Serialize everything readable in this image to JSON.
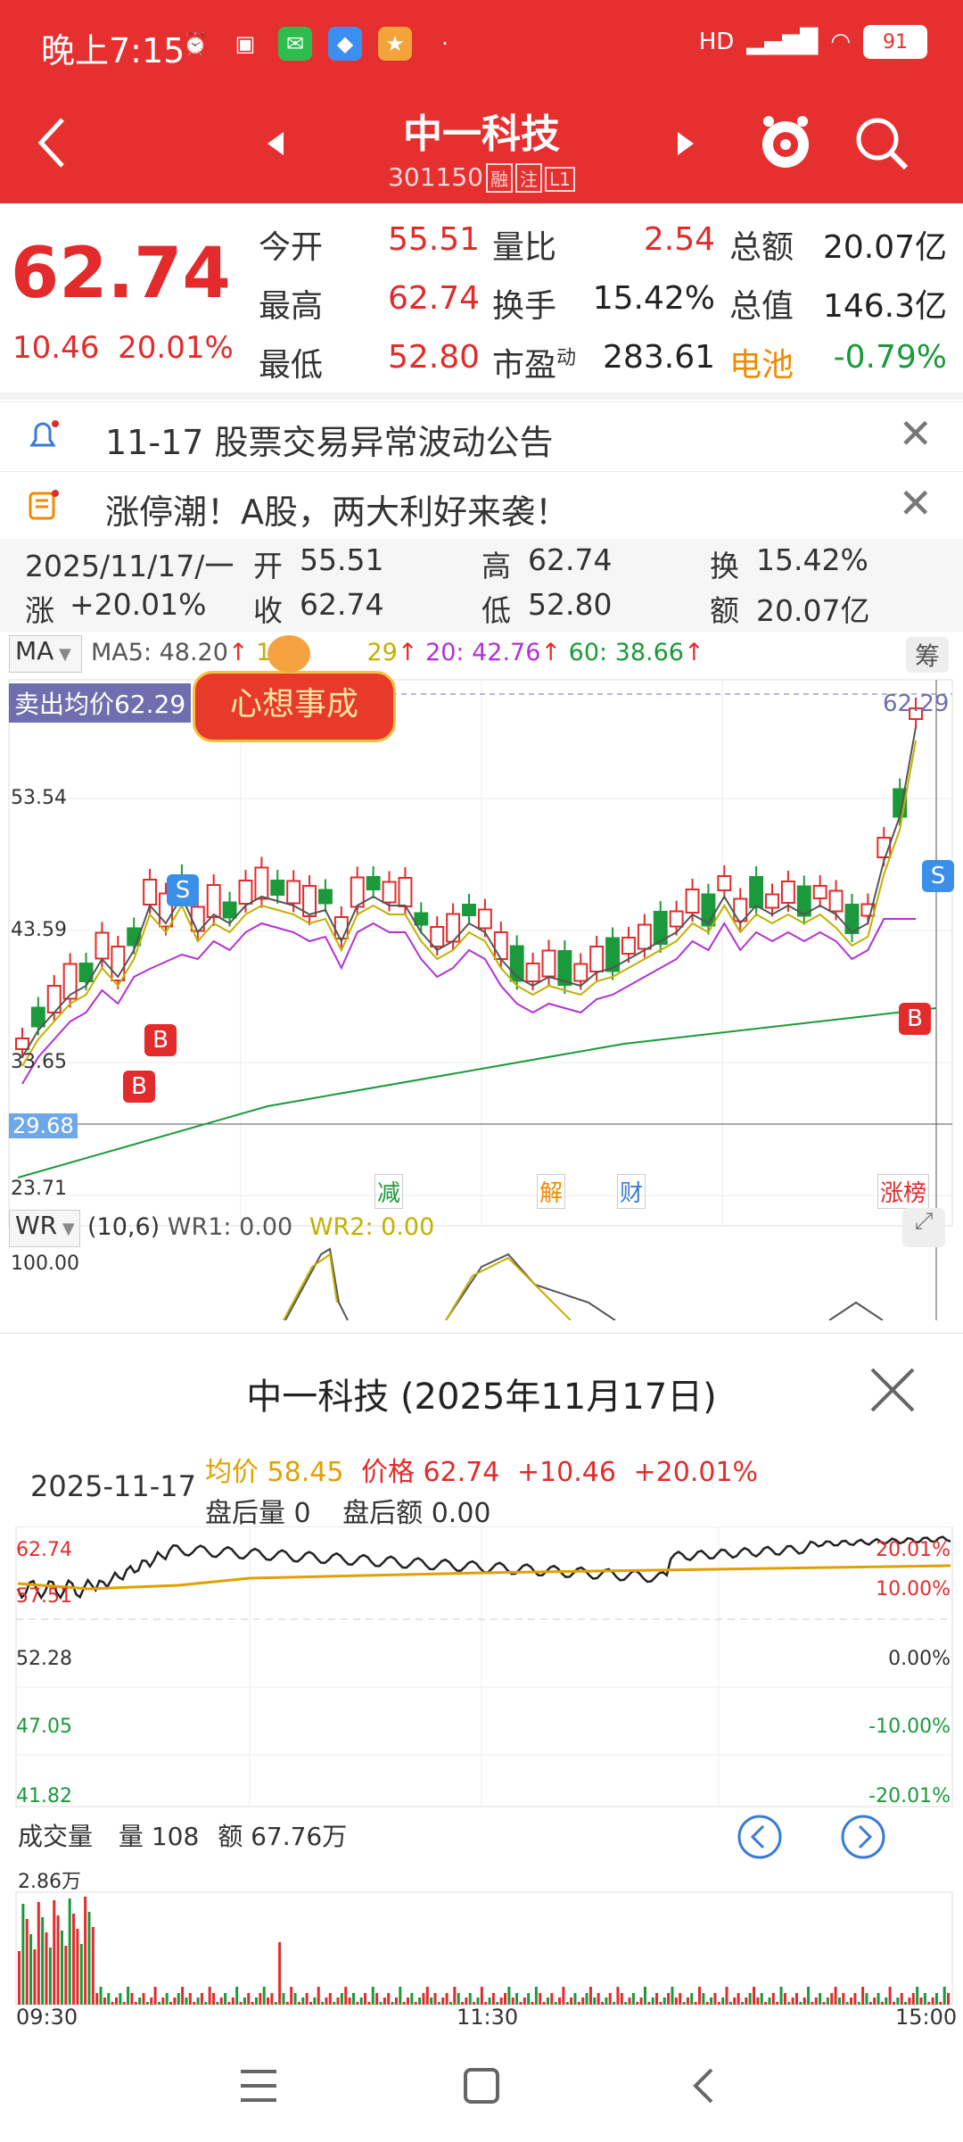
{
  "status_bar": {
    "time": "晚上7:15",
    "signal": "HD",
    "battery": "91"
  },
  "header": {
    "title": "中一科技",
    "code": "301150",
    "tags": [
      "融",
      "注",
      "L1"
    ]
  },
  "quote": {
    "price": "62.74",
    "change": "10.46",
    "change_pct": "20.01%",
    "rows": [
      [
        {
          "label": "今开",
          "value": "55.51"
        },
        {
          "label": "量比",
          "value": "2.54"
        },
        {
          "label": "总额",
          "value": "20.07亿"
        }
      ],
      [
        {
          "label": "最高",
          "value": "62.74"
        },
        {
          "label": "换手",
          "value": "15.42%"
        },
        {
          "label": "总值",
          "value": "146.3亿"
        }
      ],
      [
        {
          "label": "最低",
          "value": "52.80"
        },
        {
          "label": "市盈",
          "label_sup": "动",
          "value": "283.61"
        },
        {
          "label": "电池",
          "value": "-0.79%"
        }
      ]
    ]
  },
  "notices": [
    {
      "text": "11-17 股票交易异常波动公告"
    },
    {
      "text": "涨停潮！A股，两大利好来袭！"
    }
  ],
  "day_info": {
    "date": "2025/11/17/一",
    "open_label": "开",
    "open": "55.51",
    "high_label": "高",
    "high": "62.74",
    "turn_label": "换",
    "turn": "15.42%",
    "chg_label": "涨",
    "chg": "+20.01%",
    "close_label": "收",
    "close": "62.74",
    "low_label": "低",
    "low": "52.80",
    "amt_label": "额",
    "amt": "20.07亿"
  },
  "ma": {
    "selector": "MA",
    "ma5": "MA5: 48.20",
    "ma10": "10",
    "ma10_tail": "29",
    "ma20": "20: 42.76",
    "ma60": "60: 38.66",
    "chip_btn": "筹",
    "sell_avg": "卖出均价62.29",
    "sticker": "心想事成",
    "right_price": "62.29"
  },
  "kline_axis": [
    "53.54",
    "43.59",
    "33.65",
    "29.68",
    "23.71"
  ],
  "kline_events": [
    {
      "label": "减",
      "color": "#1a9a3a"
    },
    {
      "label": "解",
      "color": "#f08a00"
    },
    {
      "label": "财",
      "color": "#3a7bd5"
    },
    {
      "label": "涨榜",
      "color": "#e32b2b"
    }
  ],
  "markers": {
    "s": "S",
    "b": "B"
  },
  "wr": {
    "selector": "WR",
    "params": "(10,6)",
    "wr1": "WR1: 0.00",
    "wr2": "WR2: 0.00",
    "top": "100.00"
  },
  "sheet": {
    "title": "中一科技 (2025年11月17日)",
    "date": "2025-11-17",
    "avg": "均价 58.45",
    "price": "价格 62.74",
    "chg": "+10.46",
    "chg_pct": "+20.01%",
    "after_vol": "盘后量 0",
    "after_amt": "盘后额 0.00",
    "left_axis": [
      "62.74",
      "57.51",
      "52.28",
      "47.05",
      "41.82"
    ],
    "right_axis": [
      "20.01%",
      "10.00%",
      "0.00%",
      "-10.00%",
      "-20.01%"
    ],
    "vol_label": "成交量",
    "vol": "量 108",
    "amt": "额 67.76万",
    "vol_top": "2.86万",
    "time_axis": [
      "09:30",
      "11:30",
      "15:00"
    ]
  },
  "colors": {
    "red": "#e32b2b",
    "green": "#1a9a3a",
    "brand": "#e63030"
  }
}
